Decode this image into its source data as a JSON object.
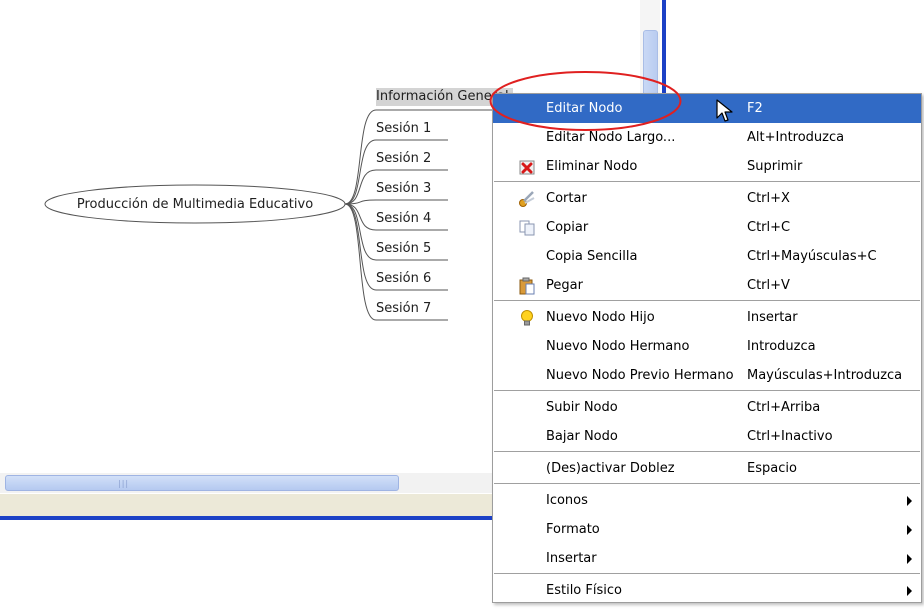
{
  "mindmap": {
    "central_node": "Producción de Multimedia Educativo",
    "children": [
      "Información General",
      "Sesión 1",
      "Sesión 2",
      "Sesión 3",
      "Sesión 4",
      "Sesión 5",
      "Sesión 6",
      "Sesión 7"
    ]
  },
  "context_menu": {
    "items": [
      {
        "label": "Editar Nodo",
        "shortcut": "F2",
        "icon": "",
        "selected": true
      },
      {
        "label": "Editar Nodo Largo...",
        "shortcut": "Alt+Introduzca",
        "icon": ""
      },
      {
        "label": "Eliminar Nodo",
        "shortcut": "Suprimir",
        "icon": "delete-icon"
      },
      {
        "label": "Cortar",
        "shortcut": "Ctrl+X",
        "icon": "scissors-icon"
      },
      {
        "label": "Copiar",
        "shortcut": "Ctrl+C",
        "icon": "copy-icon"
      },
      {
        "label": "Copia Sencilla",
        "shortcut": "Ctrl+Mayúsculas+C",
        "icon": ""
      },
      {
        "label": "Pegar",
        "shortcut": "Ctrl+V",
        "icon": "paste-icon"
      },
      {
        "label": "Nuevo Nodo Hijo",
        "shortcut": "Insertar",
        "icon": "lightbulb-icon"
      },
      {
        "label": "Nuevo Nodo Hermano",
        "shortcut": "Introduzca",
        "icon": ""
      },
      {
        "label": "Nuevo Nodo Previo Hermano",
        "shortcut": "Mayúsculas+Introduzca",
        "icon": ""
      },
      {
        "label": "Subir Nodo",
        "shortcut": "Ctrl+Arriba",
        "icon": ""
      },
      {
        "label": "Bajar Nodo",
        "shortcut": "Ctrl+Inactivo",
        "icon": ""
      },
      {
        "label": "(Des)activar Doblez",
        "shortcut": "Espacio",
        "icon": ""
      },
      {
        "label": "Iconos",
        "submenu": true
      },
      {
        "label": "Formato",
        "submenu": true
      },
      {
        "label": "Insertar",
        "submenu": true
      },
      {
        "label": "Estilo Físico",
        "submenu": true
      }
    ]
  },
  "colors": {
    "selection": "#316ac5",
    "annotation": "#e02020",
    "window_border": "#1c41c6"
  }
}
